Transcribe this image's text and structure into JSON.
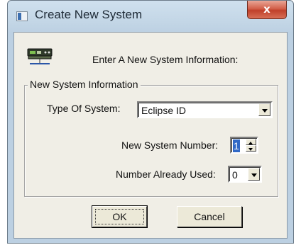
{
  "window": {
    "title": "Create New System",
    "close_label": "x"
  },
  "header": {
    "text": "Enter A New System Information:",
    "icon": "network-device-icon"
  },
  "group": {
    "legend": "New System Information",
    "type_label": "Type Of System:",
    "type_value": "Eclipse ID",
    "number_label": "New System Number:",
    "number_value": "1",
    "used_label": "Number Already Used:",
    "used_value": "0"
  },
  "buttons": {
    "ok_label": "OK",
    "cancel_label": "Cancel"
  },
  "colors": {
    "selection": "#3169c6",
    "close_button": "#c0402a",
    "dialog_face": "#f0eee6"
  }
}
